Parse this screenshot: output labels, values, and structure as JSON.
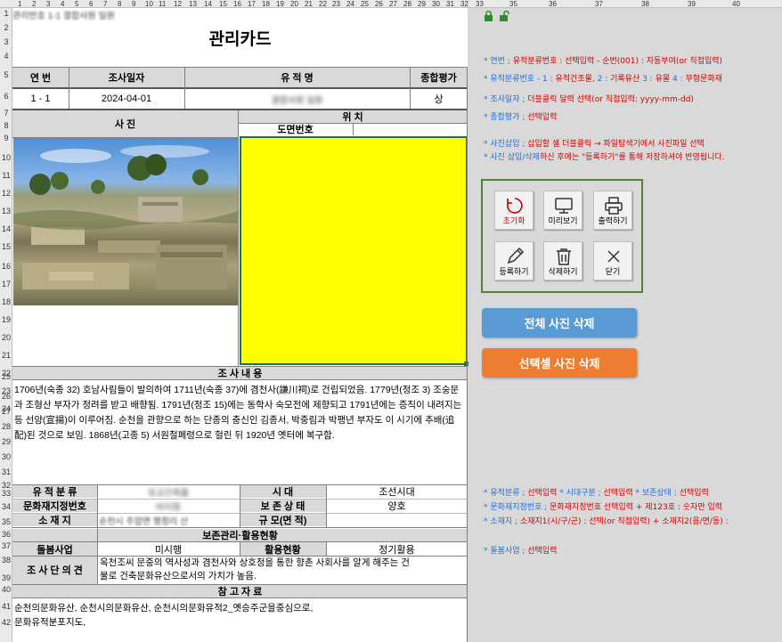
{
  "column_headers": [
    "1",
    "2",
    "3",
    "4",
    "5",
    "6",
    "7",
    "8",
    "9",
    "10",
    "11",
    "12",
    "13",
    "14",
    "15",
    "16",
    "17",
    "18",
    "19",
    "20",
    "21",
    "22",
    "23",
    "24",
    "25",
    "26",
    "27",
    "28",
    "29",
    "30",
    "31",
    "32",
    "33",
    "35",
    "36",
    "37",
    "38",
    "39",
    "40"
  ],
  "row_headers": [
    "1",
    "2",
    "3",
    "4",
    "5",
    "6",
    "7",
    "8",
    "9",
    "10",
    "11",
    "12",
    "13",
    "14",
    "15",
    "16",
    "17",
    "18",
    "19",
    "20",
    "21",
    "22",
    "23",
    "24",
    "25",
    "26",
    "27",
    "28",
    "29",
    "30",
    "31",
    "32",
    "33",
    "34",
    "35",
    "36",
    "37",
    "38",
    "39",
    "40",
    "41",
    "42"
  ],
  "lock_icons": [
    "lock-icon",
    "unlock-icon"
  ],
  "card": {
    "top_left_label": "관리번호 1-1 결합사원 일원",
    "title": "관리카드",
    "col_yeonbeon": "연 번",
    "col_date": "조사일자",
    "col_name": "유 적 명",
    "col_grade": "종합평가",
    "val_yeonbeon": "1  -  1",
    "val_date": "2024-04-01",
    "val_name": "결합사원 일원",
    "val_grade": "상",
    "photo_label": "사 진",
    "location_label": "위 치",
    "map_no_label": "도면번호",
    "survey_label": "조 사 내 용",
    "survey_text": "1706년(숙종 32) 호남사림들이 발의하여 1711년(숙종 37)에 겸천사(謙川祠)로 건립되었음. 1779년(정조 3) 조숭문과 조형산 부자가 정려를 받고 배향됨. 1791년(정조 15)에는 동학사 숙모전에 제향되고 1791년에는 증직이 내려지는 등 선양(宣揚)이 이루어짐. 순천을 관향으로 하는 단종의 충신인 김종서, 박중림과 박팽년 부자도 이 시기에 추배(追配)된 것으로 보임. 1868년(고종 5) 서원철폐령으로 헐린 뒤 1920년 옛터에 복구함.",
    "lbl_category": "유 적 분 류",
    "val_category": "유교건축물",
    "lbl_era": "시 대",
    "val_era": "조선시대",
    "lbl_heritage_no": "문화재지정번호",
    "val_heritage_no": "비지정",
    "lbl_condition": "보 존 상 태",
    "val_condition": "양호",
    "lbl_address": "소 재 지",
    "val_address": "순천시 주암면 행정리 산",
    "lbl_size": "규 모(면 적)",
    "val_size": "",
    "mgmt_label": "보존관리·활용현황",
    "lbl_care": "돌봄사업",
    "lbl_usage": "활용현황",
    "val_care": "미시행",
    "val_usage": "정기활용",
    "lbl_opinion": "조 사 단 의 견",
    "val_opinion_1": "옥천조씨 문중의 역사성과 겸천사와 상호정을 통한 향촌 사회사를 알게 해주는 건",
    "val_opinion_2": "물로 건축문화유산으로서의 가치가 높음.",
    "ref_label": "참 고 자 료",
    "ref_1": "순천의문화유산, 순천시의문화유산, 순천시의문화유적2_옛승주군을중심으로,",
    "ref_2": "문화유적분포지도,"
  },
  "notes_top": [
    [
      {
        "t": "* 연번 ; ",
        "c": "b"
      },
      {
        "t": "유적분류번호 : 선택입력 - 순번(001) : 자동부여(or 직접입력)",
        "c": "r"
      }
    ],
    [
      {
        "t": "* 유적분류번호 - 1 : ",
        "c": "b"
      },
      {
        "t": "유적건조물, ",
        "c": "r"
      },
      {
        "t": "2 : ",
        "c": "b"
      },
      {
        "t": "기록유산  ",
        "c": "r"
      },
      {
        "t": "3 : ",
        "c": "b"
      },
      {
        "t": "유물  ",
        "c": "r"
      },
      {
        "t": "4 : ",
        "c": "b"
      },
      {
        "t": "무형문화재",
        "c": "r"
      }
    ],
    [
      {
        "t": "* 조사일자 ; ",
        "c": "b"
      },
      {
        "t": "더블클릭 달력 선택(or 직접입력: yyyy-mm-dd)",
        "c": "r"
      }
    ],
    [
      {
        "t": "* 종합평가 ; ",
        "c": "b"
      },
      {
        "t": "선택입력",
        "c": "r"
      }
    ],
    [
      {
        "t": "* 사진삽입 ; ",
        "c": "b"
      },
      {
        "t": "삽입할 셀 더블클릭 → 파일탐색기에서 사진파일 선택",
        "c": "r"
      }
    ],
    [
      {
        "t": "* 사진 삽입/삭제",
        "c": "b"
      },
      {
        "t": "하신 후에는 \"등록하기\"를 통해 저장하셔야 반영됩니다.",
        "c": "r"
      }
    ]
  ],
  "notes_bottom": [
    [
      {
        "t": "* 유적분류 ; ",
        "c": "b"
      },
      {
        "t": "선택입력",
        "c": "r"
      },
      {
        "t": "   * 시대구분 ; ",
        "c": "b"
      },
      {
        "t": "선택입력",
        "c": "r"
      },
      {
        "t": "   * 보존상태 ; ",
        "c": "b"
      },
      {
        "t": "선택입력",
        "c": "r"
      }
    ],
    [
      {
        "t": "* 문화재지정번호 ; ",
        "c": "b"
      },
      {
        "t": "문화재지정번호 선택입력 + 제123호 : 숫자만 입력",
        "c": "r"
      }
    ],
    [
      {
        "t": "* 소재지 ; ",
        "c": "b"
      },
      {
        "t": "소재지1(시/구/군) : 선택(or 직접입력) + 소재지2(읍/면/동) :",
        "c": "r"
      }
    ],
    [
      {
        "t": "* 돌봄사업 ; ",
        "c": "b"
      },
      {
        "t": "선택입력",
        "c": "r"
      }
    ]
  ],
  "buttons": {
    "reset": "초기화",
    "preview": "미리보기",
    "print": "출력하기",
    "register": "등록하기",
    "delete": "삭제하기",
    "close": "닫기",
    "delete_all_photos": "전체 사진 삭제",
    "delete_selected_photo": "선택셀 사진 삭제"
  },
  "colors": {
    "selected_cell": "#ffff00",
    "btn_blue": "#5b9bd5",
    "btn_orange": "#ed7d31",
    "panel_border": "#548235",
    "side_bg": "#d9d9d9"
  }
}
